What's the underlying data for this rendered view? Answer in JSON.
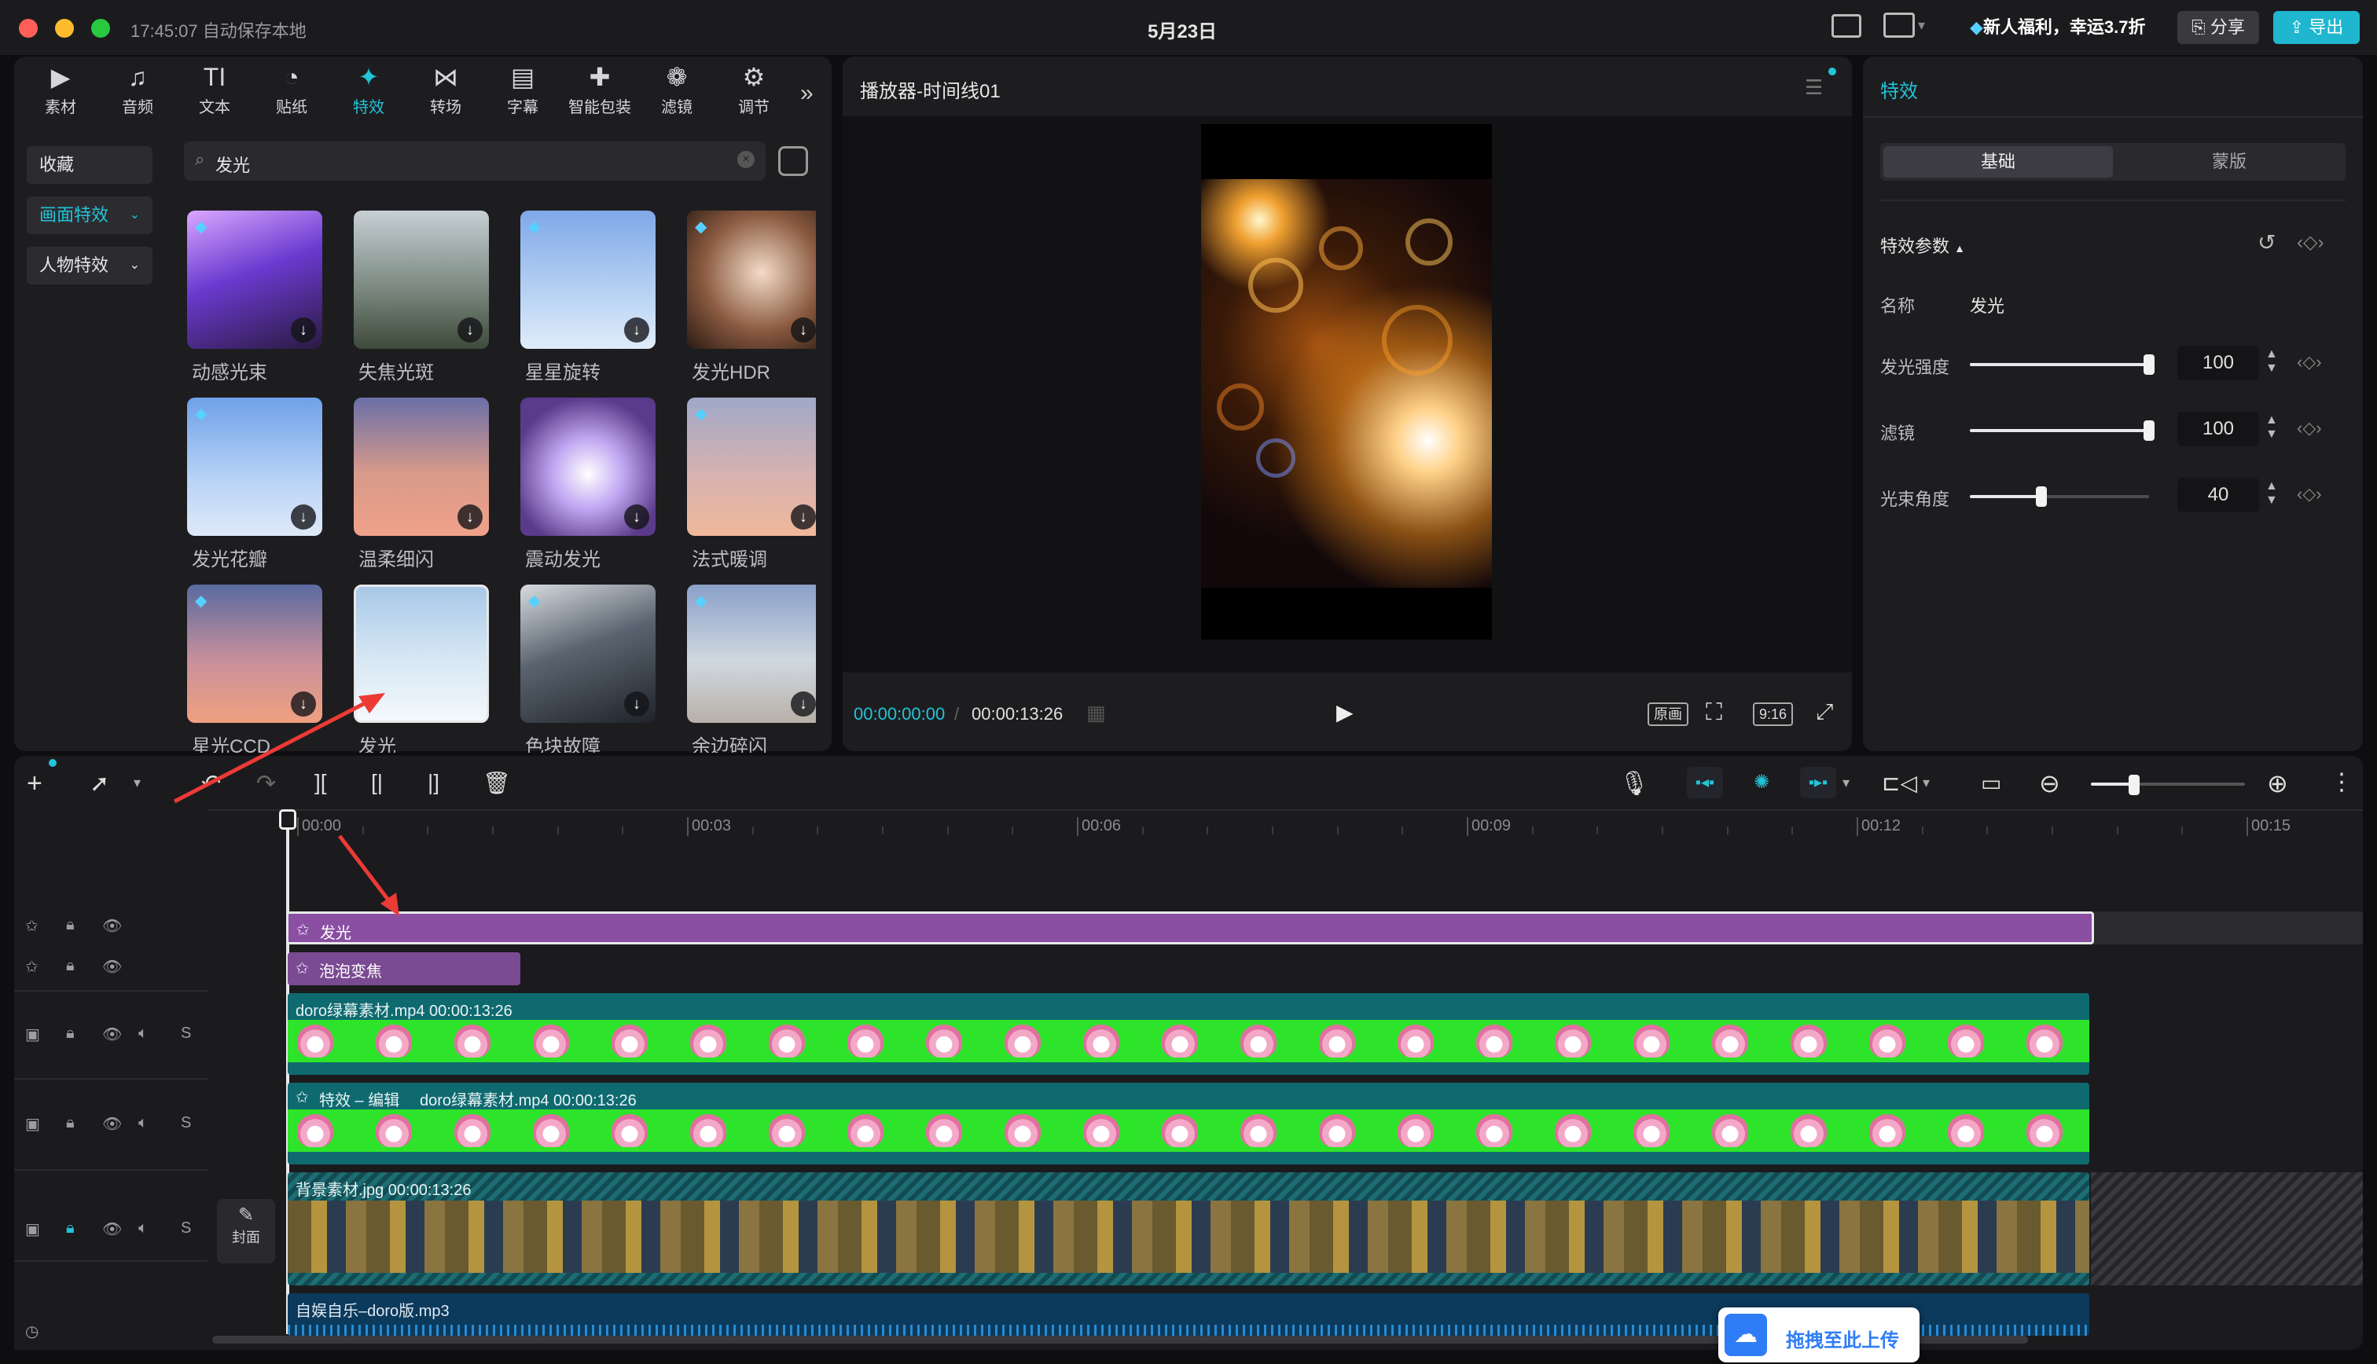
{
  "titlebar": {
    "time_status": "17:45:07 自动保存本地",
    "title": "5月23日",
    "promo": "新人福利，幸运3.7折",
    "share": "分享",
    "export": "导出"
  },
  "toolbar": {
    "tools": [
      {
        "label": "素材",
        "icon": "media-icon"
      },
      {
        "label": "音频",
        "icon": "audio-icon"
      },
      {
        "label": "文本",
        "icon": "text-icon"
      },
      {
        "label": "贴纸",
        "icon": "sticker-icon"
      },
      {
        "label": "特效",
        "icon": "effects-icon"
      },
      {
        "label": "转场",
        "icon": "transition-icon"
      },
      {
        "label": "字幕",
        "icon": "subtitle-icon"
      },
      {
        "label": "智能包装",
        "icon": "smart-pack-icon"
      },
      {
        "label": "滤镜",
        "icon": "filter-icon"
      },
      {
        "label": "调节",
        "icon": "adjust-icon"
      }
    ],
    "more": "»"
  },
  "left_sidebar": {
    "items": [
      "收藏",
      "画面特效",
      "人物特效"
    ]
  },
  "search": {
    "value": "发光"
  },
  "effects_grid": [
    {
      "label": "动感光束",
      "gem": true
    },
    {
      "label": "失焦光斑",
      "gem": false
    },
    {
      "label": "星星旋转",
      "gem": true
    },
    {
      "label": "发光HDR",
      "gem": true
    },
    {
      "label": "发光花瓣",
      "gem": true
    },
    {
      "label": "温柔细闪",
      "gem": false
    },
    {
      "label": "震动发光",
      "gem": false
    },
    {
      "label": "法式暖调",
      "gem": true
    },
    {
      "label": "星光CCD",
      "gem": true
    },
    {
      "label": "发光",
      "gem": false
    },
    {
      "label": "色块故障",
      "gem": true
    },
    {
      "label": "余边碎闪",
      "gem": true
    }
  ],
  "player": {
    "title": "播放器-时间线01",
    "current_time": "00:00:00:00",
    "total_time": "00:00:13:26",
    "btn_original": "原画",
    "btn_ratio": "9:16"
  },
  "inspector": {
    "title": "特效",
    "tab_basic": "基础",
    "tab_mask": "蒙版",
    "section": "特效参数",
    "name_label": "名称",
    "name_value": "发光",
    "params": [
      {
        "label": "发光强度",
        "value": "100",
        "level": 1.0
      },
      {
        "label": "滤镜",
        "value": "100",
        "level": 1.0
      },
      {
        "label": "光束角度",
        "value": "40",
        "level": 0.4
      }
    ]
  },
  "timeline": {
    "ruler": [
      "00:00",
      "00:03",
      "00:06",
      "00:09",
      "00:12",
      "00:15"
    ],
    "tracks": {
      "effect1": "发光",
      "effect2": "泡泡变焦",
      "video1": "doro绿幕素材.mp4  00:00:13:26",
      "video2_prefix": "特效 – 编辑",
      "video2": "doro绿幕素材.mp4  00:00:13:26",
      "bg": "背景素材.jpg  00:00:13:26",
      "audio": "自娱自乐–doro版.mp3",
      "cover": "封面"
    },
    "upload": "拖拽至此上传"
  },
  "colors": {
    "accent": "#21c4d8",
    "effect_clip": "#8a4fa3",
    "video_track": "#0f6a70",
    "green_screen": "#2ee42a",
    "audio_track": "#0c3a5c"
  }
}
